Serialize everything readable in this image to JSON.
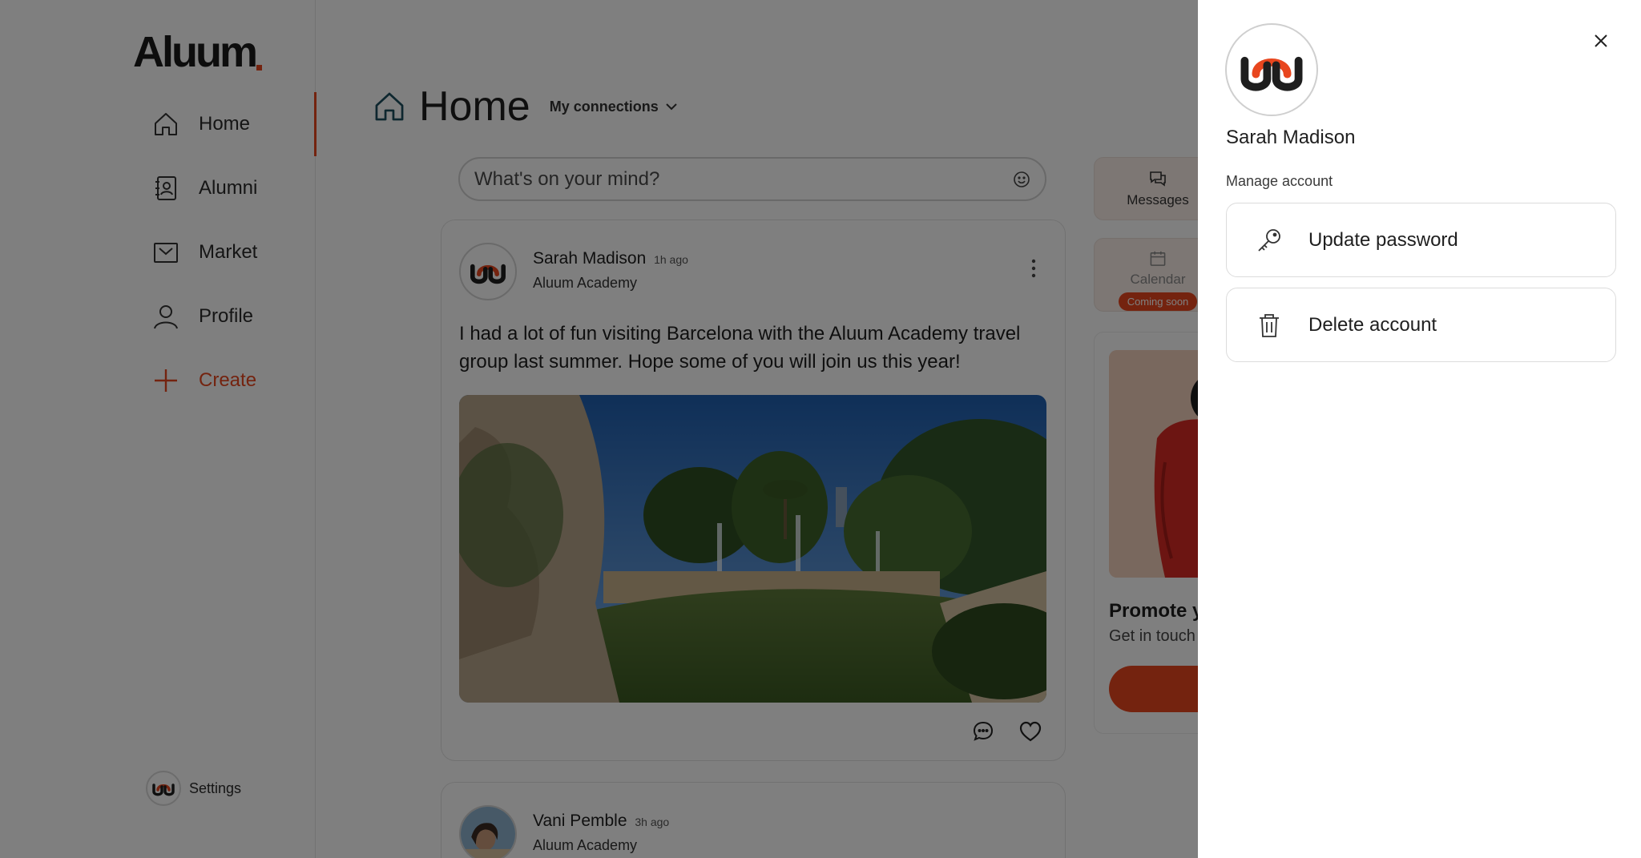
{
  "brand": {
    "logo_text": "Aluum",
    "accent": "#e8461e"
  },
  "sidebar": {
    "items": [
      {
        "label": "Home",
        "icon": "home-icon",
        "active": true
      },
      {
        "label": "Alumni",
        "icon": "contact-book-icon"
      },
      {
        "label": "Market",
        "icon": "market-icon"
      },
      {
        "label": "Profile",
        "icon": "person-icon"
      },
      {
        "label": "Create",
        "icon": "plus-icon"
      }
    ],
    "settings_label": "Settings"
  },
  "header": {
    "title": "Home",
    "filter_label": "My connections"
  },
  "composer": {
    "placeholder": "What's on your mind?"
  },
  "posts": [
    {
      "author": "Sarah Madison",
      "time": "1h ago",
      "org": "Aluum Academy",
      "text": "I had a lot of fun visiting Barcelona with the Aluum Academy travel group last summer. Hope some of you will join us this year!"
    },
    {
      "author": "Vani Pemble",
      "time": "3h ago",
      "org": "Aluum Academy"
    }
  ],
  "widgets": {
    "messages_label": "Messages",
    "calendar_label": "Calendar",
    "calendar_badge": "Coming soon",
    "promo_title": "Promote y",
    "promo_sub": "Get in touch"
  },
  "drawer": {
    "user_name": "Sarah Madison",
    "section_label": "Manage account",
    "update_password_label": "Update password",
    "delete_account_label": "Delete account"
  }
}
